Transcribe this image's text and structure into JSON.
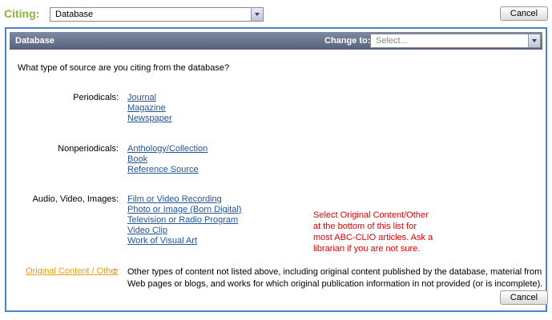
{
  "header": {
    "citing_label": "Citing:",
    "citing_value": "Database",
    "cancel_label": "Cancel"
  },
  "panel": {
    "title": "Database",
    "change_label": "Change to:",
    "change_placeholder": "Select...",
    "question": "What type of source are you citing from the database?",
    "categories": [
      {
        "label": "Periodicals:",
        "links": [
          "Journal",
          "Magazine",
          "Newspaper"
        ]
      },
      {
        "label": "Nonperiodicals:",
        "links": [
          "Anthology/Collection",
          "Book",
          "Reference Source"
        ]
      },
      {
        "label": "Audio, Video, Images:",
        "links": [
          "Film or Video Recording",
          "Photo or Image (Born Digital)",
          "Television or Radio Program",
          "Video Clip",
          "Work of Visual Art"
        ]
      }
    ],
    "original_link": "Original Content / Other",
    "original_colon": ":",
    "original_desc": "Other types of content not listed above, including original content published by the database, material from Web pages or blogs, and works for which original publication information in not provided (or is incomplete).",
    "note": "Select Original Content/Other at the bottom of this list for most ABC-CLIO articles. Ask a librarian if  you are not sure.",
    "cancel_label": "Cancel"
  },
  "colors": {
    "citing_label": "#8cb33a",
    "panel_border": "#4a86c6",
    "link": "#22559a",
    "original_link": "#e8a000",
    "note": "#e00000"
  }
}
